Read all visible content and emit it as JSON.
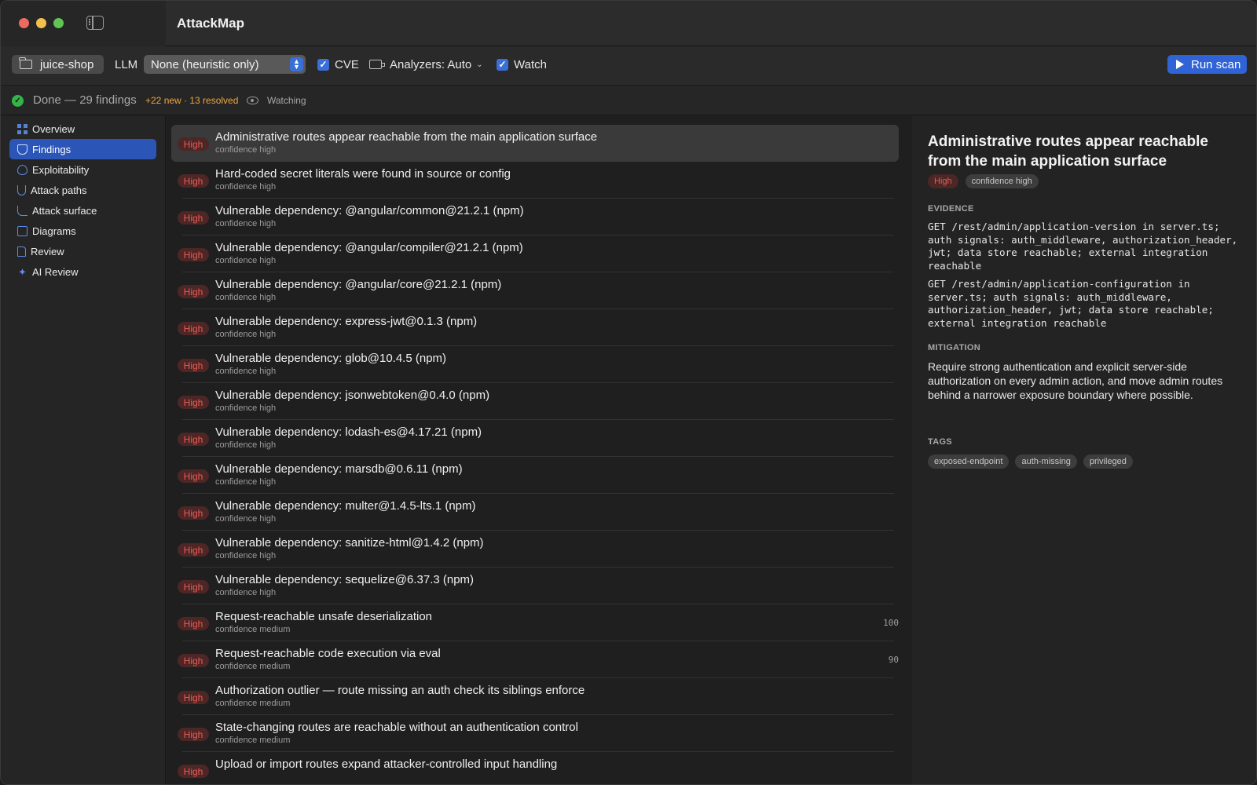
{
  "window": {
    "title": "AttackMap"
  },
  "toolbar": {
    "project": "juice-shop",
    "llm_label": "LLM",
    "llm_select_value": "None (heuristic only)",
    "cve_label": "CVE",
    "cve_checked": true,
    "analyzers_label": "Analyzers: Auto",
    "watch_label": "Watch",
    "watch_checked": true,
    "run_label": "Run scan"
  },
  "status": {
    "text": "Done — 29 findings",
    "delta": "+22 new · 13 resolved",
    "watching": "Watching"
  },
  "sidebar": {
    "items": [
      {
        "label": "Overview",
        "icon": "grid-icon"
      },
      {
        "label": "Findings",
        "icon": "shield-icon",
        "active": true
      },
      {
        "label": "Exploitability",
        "icon": "flame-icon"
      },
      {
        "label": "Attack paths",
        "icon": "fork-icon"
      },
      {
        "label": "Attack surface",
        "icon": "path-icon"
      },
      {
        "label": "Diagrams",
        "icon": "diagram-icon"
      },
      {
        "label": "Review",
        "icon": "document-icon"
      },
      {
        "label": "AI Review",
        "icon": "sparkle-icon"
      }
    ]
  },
  "findings": [
    {
      "severity": "High",
      "title": "Administrative routes appear reachable from the main application surface",
      "confidence": "confidence high",
      "score": ""
    },
    {
      "severity": "High",
      "title": "Hard-coded secret literals were found in source or config",
      "confidence": "confidence high",
      "score": ""
    },
    {
      "severity": "High",
      "title": "Vulnerable dependency: @angular/common@21.2.1 (npm)",
      "confidence": "confidence high",
      "score": ""
    },
    {
      "severity": "High",
      "title": "Vulnerable dependency: @angular/compiler@21.2.1 (npm)",
      "confidence": "confidence high",
      "score": ""
    },
    {
      "severity": "High",
      "title": "Vulnerable dependency: @angular/core@21.2.1 (npm)",
      "confidence": "confidence high",
      "score": ""
    },
    {
      "severity": "High",
      "title": "Vulnerable dependency: express-jwt@0.1.3 (npm)",
      "confidence": "confidence high",
      "score": ""
    },
    {
      "severity": "High",
      "title": "Vulnerable dependency: glob@10.4.5 (npm)",
      "confidence": "confidence high",
      "score": ""
    },
    {
      "severity": "High",
      "title": "Vulnerable dependency: jsonwebtoken@0.4.0 (npm)",
      "confidence": "confidence high",
      "score": ""
    },
    {
      "severity": "High",
      "title": "Vulnerable dependency: lodash-es@4.17.21 (npm)",
      "confidence": "confidence high",
      "score": ""
    },
    {
      "severity": "High",
      "title": "Vulnerable dependency: marsdb@0.6.11 (npm)",
      "confidence": "confidence high",
      "score": ""
    },
    {
      "severity": "High",
      "title": "Vulnerable dependency: multer@1.4.5-lts.1 (npm)",
      "confidence": "confidence high",
      "score": ""
    },
    {
      "severity": "High",
      "title": "Vulnerable dependency: sanitize-html@1.4.2 (npm)",
      "confidence": "confidence high",
      "score": ""
    },
    {
      "severity": "High",
      "title": "Vulnerable dependency: sequelize@6.37.3 (npm)",
      "confidence": "confidence high",
      "score": ""
    },
    {
      "severity": "High",
      "title": "Request-reachable unsafe deserialization",
      "confidence": "confidence medium",
      "score": "100"
    },
    {
      "severity": "High",
      "title": "Request-reachable code execution via eval",
      "confidence": "confidence medium",
      "score": "90"
    },
    {
      "severity": "High",
      "title": "Authorization outlier — route missing an auth check its siblings enforce",
      "confidence": "confidence medium",
      "score": ""
    },
    {
      "severity": "High",
      "title": "State-changing routes are reachable without an authentication control",
      "confidence": "confidence medium",
      "score": ""
    },
    {
      "severity": "High",
      "title": "Upload or import routes expand attacker-controlled input handling",
      "confidence": "",
      "score": ""
    }
  ],
  "detail": {
    "title": "Administrative routes appear reachable from the main application surface",
    "severity": "High",
    "confidence": "confidence high",
    "evidence_heading": "EVIDENCE",
    "evidence": [
      "GET /rest/admin/application-version in server.ts; auth signals: auth_middleware, authorization_header, jwt; data store reachable; external integration reachable",
      "GET /rest/admin/application-configuration in server.ts; auth signals: auth_middleware, authorization_header, jwt; data store reachable; external integration reachable"
    ],
    "mitigation_heading": "MITIGATION",
    "mitigation": "Require strong authentication and explicit server-side authorization on every admin action, and move admin routes behind a narrower exposure boundary where possible.",
    "tags_heading": "TAGS",
    "tags": [
      "exposed-endpoint",
      "auth-missing",
      "privileged"
    ]
  },
  "colors": {
    "accent": "#2f63d6",
    "sidebar_active": "#2c55b8",
    "severity_high_text": "#ec5a52",
    "severity_high_bg": "#4d2626",
    "delta_orange": "#f0a640",
    "status_green": "#35b548"
  }
}
